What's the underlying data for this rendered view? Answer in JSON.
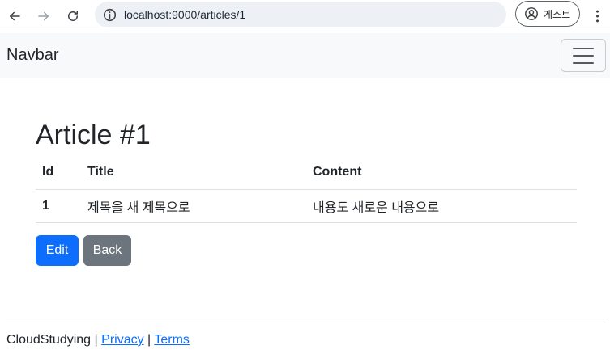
{
  "browser": {
    "address": "localhost:9000/articles/1",
    "profile_label": "게스트",
    "icons": {
      "back": "arrow-left-icon",
      "forward": "arrow-right-icon",
      "reload": "reload-icon",
      "site_info": "info-icon",
      "profile": "user-circle-icon",
      "menu": "kebab-menu-icon"
    }
  },
  "navbar": {
    "brand": "Navbar",
    "toggler_icon": "hamburger-icon"
  },
  "article": {
    "heading": "Article #1",
    "table": {
      "headers": [
        "Id",
        "Title",
        "Content"
      ],
      "rows": [
        {
          "id": "1",
          "title": "제목을 새 제목으로",
          "content": "내용도 새로운 내용으로"
        }
      ]
    },
    "buttons": {
      "edit": "Edit",
      "back": "Back"
    }
  },
  "footer": {
    "site": "CloudStudying",
    "separator": "|",
    "privacy": "Privacy",
    "terms": "Terms"
  },
  "colors": {
    "primary": "#0d6efd",
    "secondary": "#6c757d",
    "navbar_bg": "#f8f9fa",
    "address_bg": "#edf0f5"
  }
}
